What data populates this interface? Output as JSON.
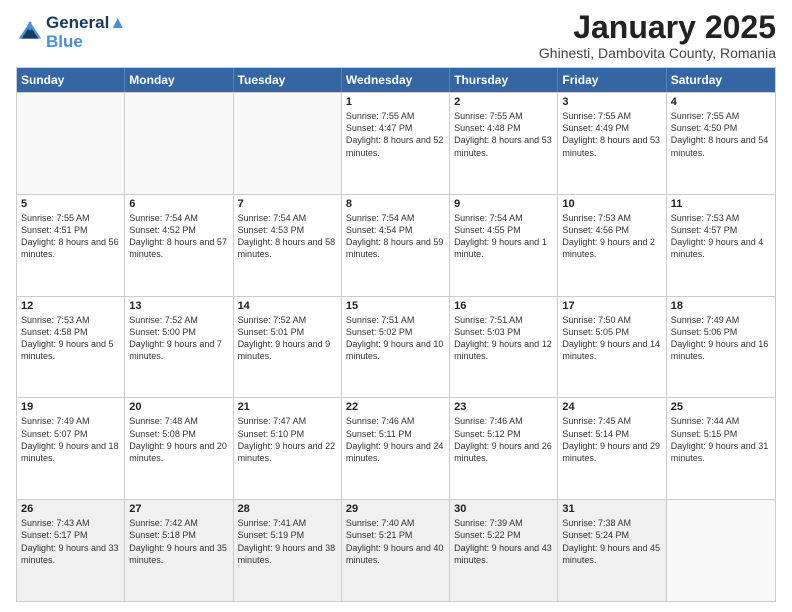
{
  "header": {
    "logo_line1": "General",
    "logo_line2": "Blue",
    "month": "January 2025",
    "location": "Ghinesti, Dambovita County, Romania"
  },
  "weekdays": [
    "Sunday",
    "Monday",
    "Tuesday",
    "Wednesday",
    "Thursday",
    "Friday",
    "Saturday"
  ],
  "rows": [
    [
      {
        "day": "",
        "text": "",
        "empty": true
      },
      {
        "day": "",
        "text": "",
        "empty": true
      },
      {
        "day": "",
        "text": "",
        "empty": true
      },
      {
        "day": "1",
        "text": "Sunrise: 7:55 AM\nSunset: 4:47 PM\nDaylight: 8 hours and 52 minutes."
      },
      {
        "day": "2",
        "text": "Sunrise: 7:55 AM\nSunset: 4:48 PM\nDaylight: 8 hours and 53 minutes."
      },
      {
        "day": "3",
        "text": "Sunrise: 7:55 AM\nSunset: 4:49 PM\nDaylight: 8 hours and 53 minutes."
      },
      {
        "day": "4",
        "text": "Sunrise: 7:55 AM\nSunset: 4:50 PM\nDaylight: 8 hours and 54 minutes."
      }
    ],
    [
      {
        "day": "5",
        "text": "Sunrise: 7:55 AM\nSunset: 4:51 PM\nDaylight: 8 hours and 56 minutes."
      },
      {
        "day": "6",
        "text": "Sunrise: 7:54 AM\nSunset: 4:52 PM\nDaylight: 8 hours and 57 minutes."
      },
      {
        "day": "7",
        "text": "Sunrise: 7:54 AM\nSunset: 4:53 PM\nDaylight: 8 hours and 58 minutes."
      },
      {
        "day": "8",
        "text": "Sunrise: 7:54 AM\nSunset: 4:54 PM\nDaylight: 8 hours and 59 minutes."
      },
      {
        "day": "9",
        "text": "Sunrise: 7:54 AM\nSunset: 4:55 PM\nDaylight: 9 hours and 1 minute."
      },
      {
        "day": "10",
        "text": "Sunrise: 7:53 AM\nSunset: 4:56 PM\nDaylight: 9 hours and 2 minutes."
      },
      {
        "day": "11",
        "text": "Sunrise: 7:53 AM\nSunset: 4:57 PM\nDaylight: 9 hours and 4 minutes."
      }
    ],
    [
      {
        "day": "12",
        "text": "Sunrise: 7:53 AM\nSunset: 4:58 PM\nDaylight: 9 hours and 5 minutes."
      },
      {
        "day": "13",
        "text": "Sunrise: 7:52 AM\nSunset: 5:00 PM\nDaylight: 9 hours and 7 minutes."
      },
      {
        "day": "14",
        "text": "Sunrise: 7:52 AM\nSunset: 5:01 PM\nDaylight: 9 hours and 9 minutes."
      },
      {
        "day": "15",
        "text": "Sunrise: 7:51 AM\nSunset: 5:02 PM\nDaylight: 9 hours and 10 minutes."
      },
      {
        "day": "16",
        "text": "Sunrise: 7:51 AM\nSunset: 5:03 PM\nDaylight: 9 hours and 12 minutes."
      },
      {
        "day": "17",
        "text": "Sunrise: 7:50 AM\nSunset: 5:05 PM\nDaylight: 9 hours and 14 minutes."
      },
      {
        "day": "18",
        "text": "Sunrise: 7:49 AM\nSunset: 5:06 PM\nDaylight: 9 hours and 16 minutes."
      }
    ],
    [
      {
        "day": "19",
        "text": "Sunrise: 7:49 AM\nSunset: 5:07 PM\nDaylight: 9 hours and 18 minutes."
      },
      {
        "day": "20",
        "text": "Sunrise: 7:48 AM\nSunset: 5:08 PM\nDaylight: 9 hours and 20 minutes."
      },
      {
        "day": "21",
        "text": "Sunrise: 7:47 AM\nSunset: 5:10 PM\nDaylight: 9 hours and 22 minutes."
      },
      {
        "day": "22",
        "text": "Sunrise: 7:46 AM\nSunset: 5:11 PM\nDaylight: 9 hours and 24 minutes."
      },
      {
        "day": "23",
        "text": "Sunrise: 7:46 AM\nSunset: 5:12 PM\nDaylight: 9 hours and 26 minutes."
      },
      {
        "day": "24",
        "text": "Sunrise: 7:45 AM\nSunset: 5:14 PM\nDaylight: 9 hours and 29 minutes."
      },
      {
        "day": "25",
        "text": "Sunrise: 7:44 AM\nSunset: 5:15 PM\nDaylight: 9 hours and 31 minutes."
      }
    ],
    [
      {
        "day": "26",
        "text": "Sunrise: 7:43 AM\nSunset: 5:17 PM\nDaylight: 9 hours and 33 minutes."
      },
      {
        "day": "27",
        "text": "Sunrise: 7:42 AM\nSunset: 5:18 PM\nDaylight: 9 hours and 35 minutes."
      },
      {
        "day": "28",
        "text": "Sunrise: 7:41 AM\nSunset: 5:19 PM\nDaylight: 9 hours and 38 minutes."
      },
      {
        "day": "29",
        "text": "Sunrise: 7:40 AM\nSunset: 5:21 PM\nDaylight: 9 hours and 40 minutes."
      },
      {
        "day": "30",
        "text": "Sunrise: 7:39 AM\nSunset: 5:22 PM\nDaylight: 9 hours and 43 minutes."
      },
      {
        "day": "31",
        "text": "Sunrise: 7:38 AM\nSunset: 5:24 PM\nDaylight: 9 hours and 45 minutes."
      },
      {
        "day": "",
        "text": "",
        "empty": true
      }
    ]
  ]
}
